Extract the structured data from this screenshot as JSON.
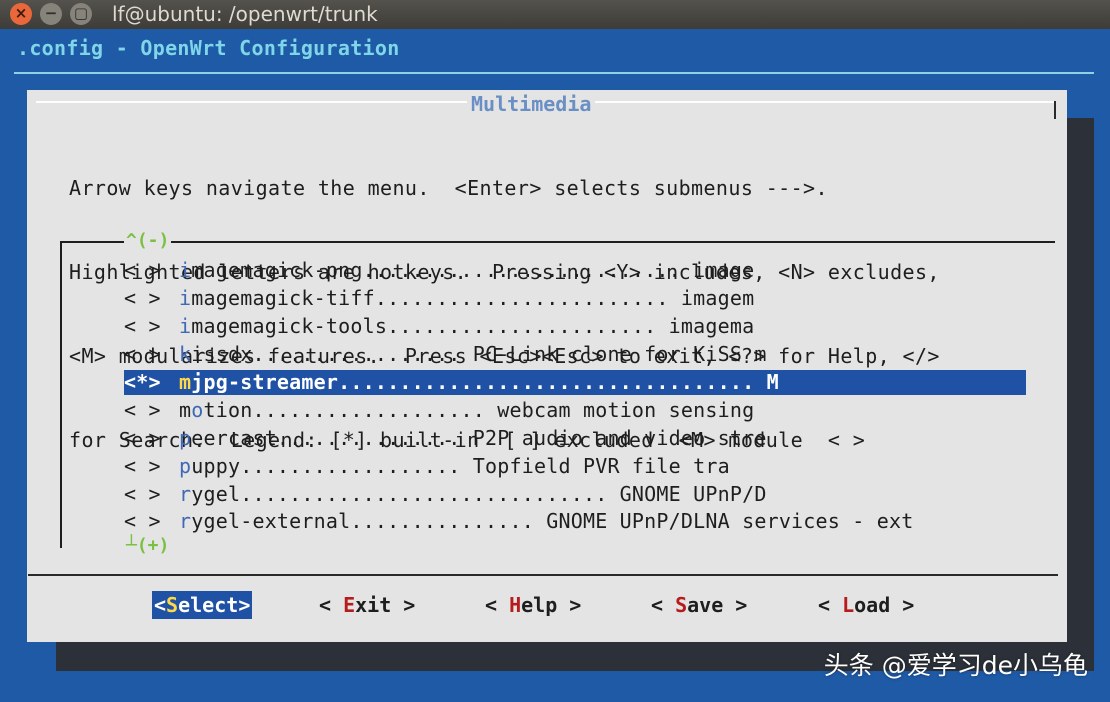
{
  "window": {
    "title": "lf@ubuntu: /openwrt/trunk",
    "close_icon": "×",
    "minimize_icon": "−",
    "maximize_icon": "▢"
  },
  "backtitle": ".config - OpenWrt Configuration",
  "dialog": {
    "title": "Multimedia",
    "help_lines": [
      "Arrow keys navigate the menu.  <Enter> selects submenus --->.",
      "Highlighted letters are hotkeys.  Pressing <Y> includes, <N> excludes,",
      "<M> modularizes features.  Press <Esc><Esc> to exit, <?> for Help, </>",
      "for Search.  Legend: [*] built-in  [ ] excluded  <M> module  < >"
    ],
    "scroll_up": "^(-)",
    "scroll_down": "┴(+)"
  },
  "menu": {
    "items": [
      {
        "mark": "< >",
        "hotkey": "i",
        "rest": "magemagick-png.......................... image"
      },
      {
        "mark": "< >",
        "hotkey": "i",
        "rest": "magemagick-tiff........................ imagem"
      },
      {
        "mark": "< >",
        "hotkey": "i",
        "rest": "magemagick-tools...................... imagema"
      },
      {
        "mark": "< >",
        "hotkey": "k",
        "rest": "issdx................. PC-Link clone for KiSS m"
      },
      {
        "mark": "<*>",
        "hotkey": "m",
        "rest": "jpg-streamer.................................. M",
        "selected": true
      },
      {
        "mark": "< >",
        "prefix": "m",
        "hotkey": "o",
        "rest": "tion................... webcam motion sensing"
      },
      {
        "mark": "< >",
        "hotkey": "p",
        "rest": "eercast............... P2P audio and video stre"
      },
      {
        "mark": "< >",
        "hotkey": "p",
        "rest": "uppy.................. Topfield PVR file tra"
      },
      {
        "mark": "< >",
        "hotkey": "r",
        "rest": "ygel.............................. GNOME UPnP/D"
      },
      {
        "mark": "< >",
        "hotkey": "r",
        "rest": "ygel-external............... GNOME UPnP/DLNA services - ext"
      }
    ]
  },
  "buttons": [
    {
      "open": "<",
      "hotkey": "S",
      "rest": "elect",
      "close": ">",
      "active": true
    },
    {
      "open": "< ",
      "hotkey": "E",
      "rest": "xit",
      "close": " >"
    },
    {
      "open": "< ",
      "hotkey": "H",
      "rest": "elp",
      "close": " >"
    },
    {
      "open": "< ",
      "hotkey": "S",
      "rest": "ave",
      "close": " >"
    },
    {
      "open": "< ",
      "hotkey": "L",
      "rest": "oad",
      "close": " >"
    }
  ],
  "watermark": "头条 @爱学习de小乌龟",
  "colors": {
    "terminal_background": "#1f5aa6",
    "dialog_background": "#e4e4e4",
    "selection": "#1f52a5",
    "selected_hotkey": "#ffd84a",
    "menu_hotkey": "#3f68b5",
    "button_hotkey": "#b71c1c",
    "scroll_indicator": "#7ac142",
    "backtitle": "#7fd6e8"
  }
}
